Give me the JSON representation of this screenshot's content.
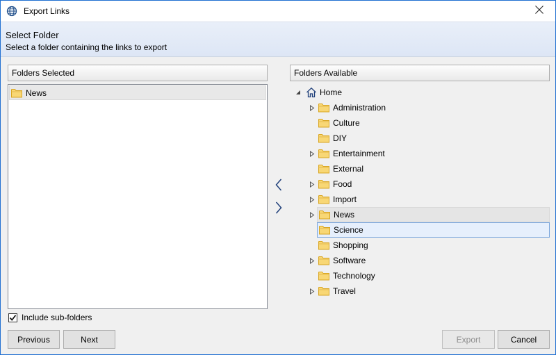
{
  "window": {
    "title": "Export Links",
    "icon": "globe-link-icon",
    "close_icon": "close-icon"
  },
  "header": {
    "title": "Select Folder",
    "subtitle": "Select a folder containing the links to export"
  },
  "selected_panel": {
    "header": "Folders Selected",
    "items": [
      {
        "label": "News",
        "icon": "folder-icon"
      }
    ]
  },
  "available_panel": {
    "header": "Folders Available",
    "root": {
      "label": "Home",
      "icon": "home-icon",
      "expanded": true
    },
    "items": [
      {
        "label": "Administration",
        "has_children": true
      },
      {
        "label": "Culture",
        "has_children": false
      },
      {
        "label": "DIY",
        "has_children": false
      },
      {
        "label": "Entertainment",
        "has_children": true
      },
      {
        "label": "External",
        "has_children": false
      },
      {
        "label": "Food",
        "has_children": true
      },
      {
        "label": "Import",
        "has_children": true
      },
      {
        "label": "News",
        "has_children": true,
        "state": "hover"
      },
      {
        "label": "Science",
        "has_children": false,
        "state": "selected"
      },
      {
        "label": "Shopping",
        "has_children": false
      },
      {
        "label": "Software",
        "has_children": true
      },
      {
        "label": "Technology",
        "has_children": false
      },
      {
        "label": "Travel",
        "has_children": true
      }
    ]
  },
  "transfer": {
    "move_left_icon": "chevron-left-icon",
    "move_right_icon": "chevron-right-icon"
  },
  "options": {
    "include_subfolders_label": "Include sub-folders",
    "include_subfolders_checked": true
  },
  "buttons": {
    "previous": "Previous",
    "next": "Next",
    "export": "Export",
    "export_enabled": false,
    "cancel": "Cancel"
  },
  "colors": {
    "header_band": "#e3eaf6",
    "selection_border": "#7aa6dd",
    "folder_fill": "#f8d775",
    "folder_stroke": "#d9a520"
  }
}
